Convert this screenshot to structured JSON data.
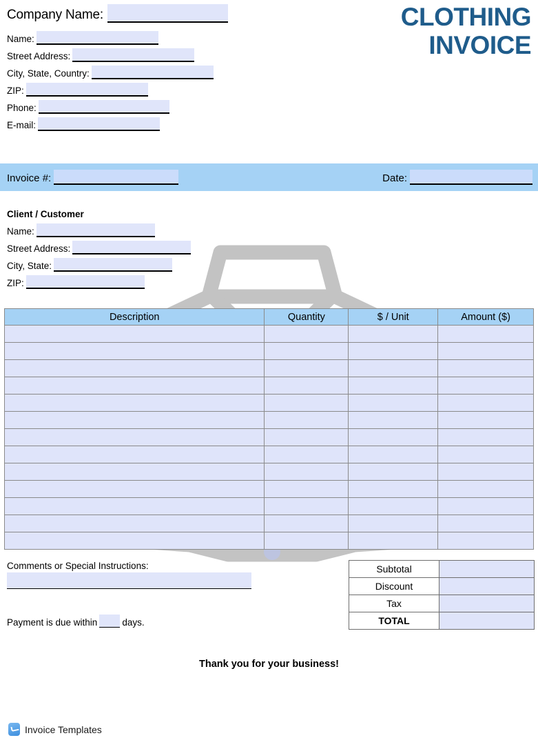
{
  "title": {
    "line1": "CLOTHING",
    "line2": "INVOICE",
    "color": "#1F5C8B"
  },
  "company": {
    "company_name_label": "Company Name:",
    "fields": [
      {
        "label": "Name:"
      },
      {
        "label": "Street Address:"
      },
      {
        "label": "City, State, Country:"
      },
      {
        "label": "ZIP:"
      },
      {
        "label": "Phone:"
      },
      {
        "label": "E-mail:"
      }
    ]
  },
  "invoice_bar": {
    "invoice_number_label": "Invoice #:",
    "date_label": "Date:",
    "background_color": "#A5D2F5"
  },
  "client": {
    "heading": "Client / Customer",
    "fields": [
      {
        "label": "Name:"
      },
      {
        "label": "Street Address:"
      },
      {
        "label": "City, State:"
      },
      {
        "label": "ZIP:"
      }
    ]
  },
  "items_table": {
    "headers": [
      "Description",
      "Quantity",
      "$ / Unit",
      "Amount ($)"
    ],
    "row_count": 13,
    "rows": [
      {
        "description": "",
        "quantity": "",
        "unit_price": "",
        "amount": ""
      },
      {
        "description": "",
        "quantity": "",
        "unit_price": "",
        "amount": ""
      },
      {
        "description": "",
        "quantity": "",
        "unit_price": "",
        "amount": ""
      },
      {
        "description": "",
        "quantity": "",
        "unit_price": "",
        "amount": ""
      },
      {
        "description": "",
        "quantity": "",
        "unit_price": "",
        "amount": ""
      },
      {
        "description": "",
        "quantity": "",
        "unit_price": "",
        "amount": ""
      },
      {
        "description": "",
        "quantity": "",
        "unit_price": "",
        "amount": ""
      },
      {
        "description": "",
        "quantity": "",
        "unit_price": "",
        "amount": ""
      },
      {
        "description": "",
        "quantity": "",
        "unit_price": "",
        "amount": ""
      },
      {
        "description": "",
        "quantity": "",
        "unit_price": "",
        "amount": ""
      },
      {
        "description": "",
        "quantity": "",
        "unit_price": "",
        "amount": ""
      },
      {
        "description": "",
        "quantity": "",
        "unit_price": "",
        "amount": ""
      },
      {
        "description": "",
        "quantity": "",
        "unit_price": "",
        "amount": ""
      }
    ],
    "header_background": "#A5D2F5",
    "cell_background": "#DFE4FA"
  },
  "comments": {
    "label": "Comments or Special Instructions:",
    "value": ""
  },
  "payment_terms": {
    "prefix": "Payment is due within",
    "days": "",
    "suffix": "days."
  },
  "totals": [
    {
      "label": "Subtotal",
      "value": "",
      "bold": false
    },
    {
      "label": "Discount",
      "value": "",
      "bold": false
    },
    {
      "label": "Tax",
      "value": "",
      "bold": false
    },
    {
      "label": "TOTAL",
      "value": "",
      "bold": true
    }
  ],
  "thank_you": "Thank you for your business!",
  "footer": {
    "brand": "Invoice Templates",
    "icon": "invoice-templates-logo-icon"
  },
  "watermark": {
    "icon": "dress-shirt-watermark-icon",
    "color": "#C4C4C4",
    "buttons": 5
  }
}
